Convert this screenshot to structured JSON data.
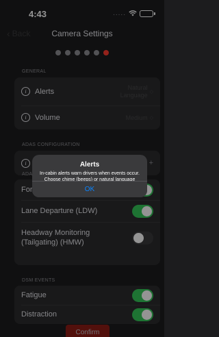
{
  "status_bar": {
    "time": "4:43",
    "signal": "....."
  },
  "nav": {
    "back_label": "Back",
    "title": "Camera Settings"
  },
  "pagination": {
    "total": 6,
    "active_index": 5,
    "active_color": "#ff3b30"
  },
  "general": {
    "label": "GENERAL",
    "alerts_label": "Alerts",
    "alerts_value_line1": "Natural",
    "alerts_value_line2": "Language",
    "volume_label": "Volume",
    "volume_value": "Medium"
  },
  "adas": {
    "label": "ADAS CONFIGURATION",
    "sub_label": "ADA",
    "forward_label": "For",
    "forward_on": true,
    "lane_label": "Lane Departure (LDW)",
    "lane_on": true,
    "headway_label": "Headway Monitoring (Tailgating) (HMW)",
    "headway_on": false,
    "plus": "+"
  },
  "dsm": {
    "label": "DSM EVENTS",
    "fatigue_label": "Fatigue",
    "fatigue_on": true,
    "distraction_label": "Distraction",
    "distraction_on": true
  },
  "alert": {
    "title": "Alerts",
    "message": "In-cabin alerts warn drivers when events occur. Choose chime (beeps) or natural language (voice).",
    "ok_label": "OK"
  },
  "confirm_label": "Confirm",
  "colors": {
    "toggle_on": "#35c759",
    "link": "#0a84ff",
    "confirm": "#8e1c16"
  }
}
